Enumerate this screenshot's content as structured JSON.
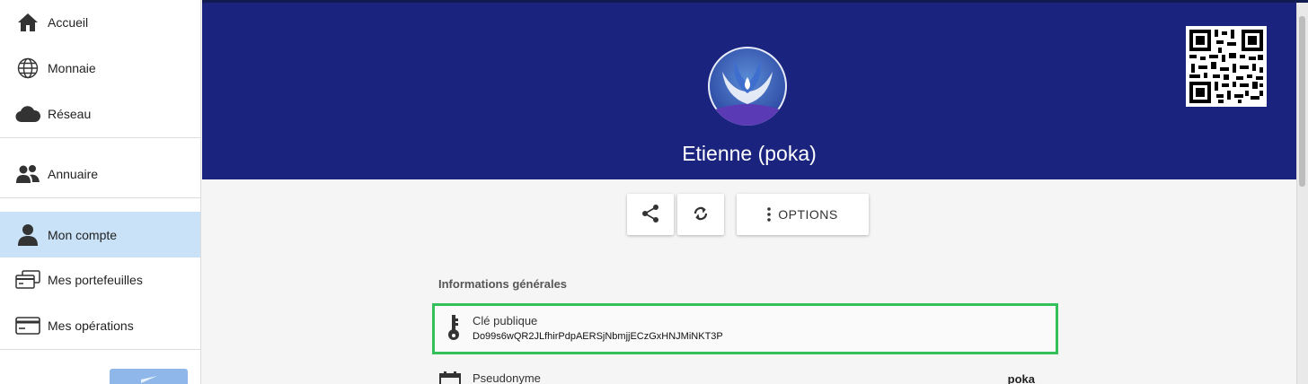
{
  "sidebar": {
    "items": [
      {
        "label": "Accueil",
        "icon": "home-icon"
      },
      {
        "label": "Monnaie",
        "icon": "globe-icon"
      },
      {
        "label": "Réseau",
        "icon": "cloud-icon"
      },
      {
        "label": "Annuaire",
        "icon": "people-icon"
      },
      {
        "label": "Mon compte",
        "icon": "person-icon",
        "active": true
      },
      {
        "label": "Mes portefeuilles",
        "icon": "wallets-icon"
      },
      {
        "label": "Mes opérations",
        "icon": "card-icon"
      }
    ]
  },
  "profile": {
    "name": "Etienne (poka)"
  },
  "actions": {
    "options_label": "OPTIONS"
  },
  "info": {
    "section_title": "Informations générales",
    "public_key_label": "Clé publique",
    "public_key_value": "Do99s6wQR2JLfhirPdpAERSjNbmjjECzGxHNJMiNKT3P",
    "pseudonym_label": "Pseudonyme",
    "pseudonym_value": "poka"
  },
  "colors": {
    "header": "#1a237e",
    "active_item": "#c9e2f7",
    "highlight_border": "#33c05a"
  }
}
